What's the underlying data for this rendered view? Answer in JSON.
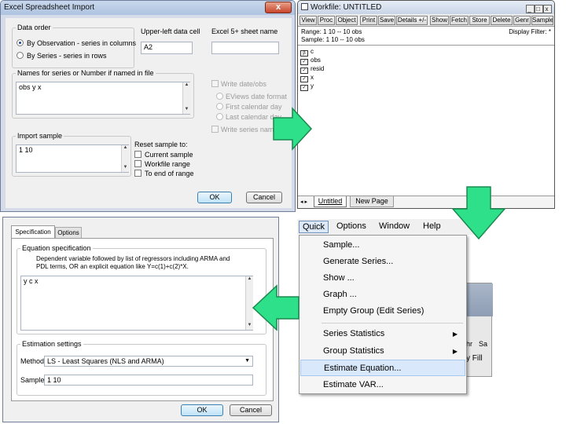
{
  "excel_dialog": {
    "title": "Excel Spreadsheet Import",
    "close_label": "x",
    "data_order": {
      "label": "Data order",
      "option_obs": "By Observation - series in columns",
      "option_series": "By Series - series in rows",
      "selected": "By Observation - series in columns"
    },
    "upper_left": {
      "label": "Upper-left data cell",
      "value": "A2"
    },
    "sheet_name": {
      "label": "Excel 5+ sheet name",
      "value": ""
    },
    "names": {
      "label": "Names for series or Number if named in file",
      "value": "obs y x"
    },
    "write": {
      "write_dates_label": "Write date/obs",
      "eviews_format": "EViews date format",
      "first_day": "First calendar day",
      "last_day": "Last calendar day",
      "write_names_label": "Write series names"
    },
    "import_sample": {
      "label": "Import sample",
      "value": "1 10"
    },
    "reset": {
      "label": "Reset sample to:",
      "current": "Current sample",
      "workfile": "Workfile range",
      "end": "To end of range"
    },
    "ok_label": "OK",
    "cancel_label": "Cancel"
  },
  "workfile": {
    "title": "Workfile: UNTITLED",
    "toolbar": [
      "View",
      "Proc",
      "Object",
      "Print",
      "Save",
      "Details +/-",
      "Show",
      "Fetch",
      "Store",
      "Delete",
      "Genr",
      "Sample"
    ],
    "range_text": "Range:  1 10   --  10 obs",
    "sample_text": "Sample: 1 10   --  10 obs",
    "display_filter": "Display Filter: *",
    "objects": [
      {
        "name": "c",
        "icon": "coef-icon",
        "glyph": "β"
      },
      {
        "name": "obs",
        "icon": "series-icon",
        "glyph": "✓"
      },
      {
        "name": "resid",
        "icon": "series-icon",
        "glyph": "✓"
      },
      {
        "name": "x",
        "icon": "series-icon",
        "glyph": "✓"
      },
      {
        "name": "y",
        "icon": "series-icon",
        "glyph": "✓"
      }
    ],
    "tabs": {
      "untitled": "Untitled",
      "new_page": "New Page"
    }
  },
  "menu": {
    "bar": [
      "Quick",
      "Options",
      "Window",
      "Help"
    ],
    "items": [
      {
        "label": "Sample...",
        "sub": false
      },
      {
        "label": "Generate Series...",
        "sub": false
      },
      {
        "label": "Show ...",
        "sub": false
      },
      {
        "label": "Graph ...",
        "sub": false
      },
      {
        "label": "Empty Group (Edit Series)",
        "sub": false
      },
      {
        "label": "Series Statistics",
        "sub": true
      },
      {
        "label": "Group Statistics",
        "sub": true
      },
      {
        "label": "Estimate Equation...",
        "sub": false,
        "highlighted": true
      },
      {
        "label": "Estimate VAR...",
        "sub": false
      }
    ],
    "behind_text": "y Fill",
    "behind_fragments": [
      "hr",
      "Sa"
    ]
  },
  "equation_dialog": {
    "tabs": [
      "Specification",
      "Options"
    ],
    "spec_group_label": "Equation specification",
    "spec_help": "Dependent variable followed by list of regressors including ARMA and PDL terms, OR an explicit equation like Y=c(1)+c(2)*X.",
    "spec_value": "y c x",
    "estimation_label": "Estimation settings",
    "method_label": "Method:",
    "method_value": "LS  - Least Squares (NLS and ARMA)",
    "sample_label": "Sample:",
    "sample_value": "1 10",
    "ok_label": "OK",
    "cancel_label": "Cancel"
  },
  "colors": {
    "arrow": "#2ee08a",
    "arrow_border": "#1a8a4f",
    "highlight": "#d9e8fb",
    "title_bar": "#b9cbe4"
  }
}
